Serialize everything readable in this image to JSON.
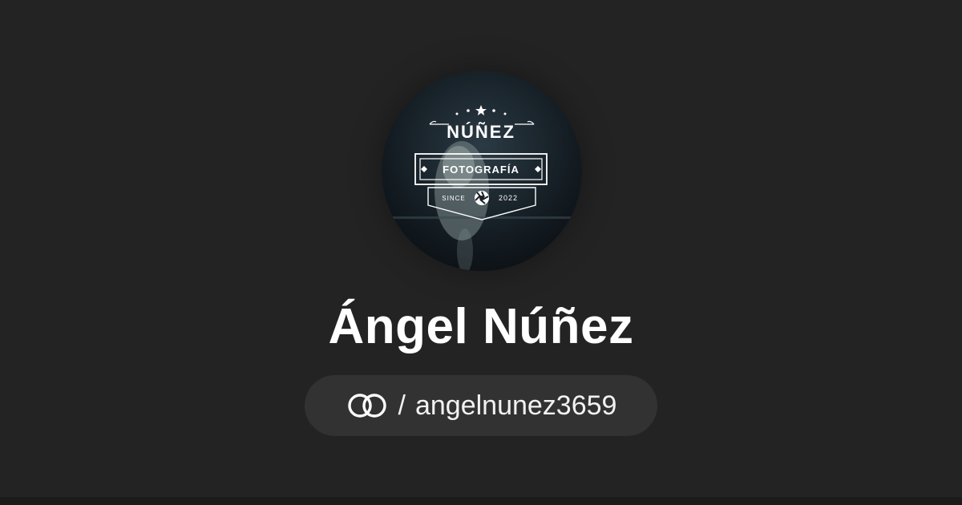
{
  "profile": {
    "display_name": "Ángel Núñez",
    "handle_separator": "/",
    "username": "angelnunez3659"
  },
  "avatar_logo": {
    "brand_name": "NÚÑEZ",
    "banner_text": "FOTOGRAFÍA",
    "since_label": "SINCE",
    "since_year": "2022"
  },
  "colors": {
    "background": "#232323",
    "pill_background": "#323232",
    "text": "#ffffff"
  },
  "icons": {
    "link_icon": "interlocking-rings-icon",
    "aperture_icon": "camera-aperture-icon"
  }
}
